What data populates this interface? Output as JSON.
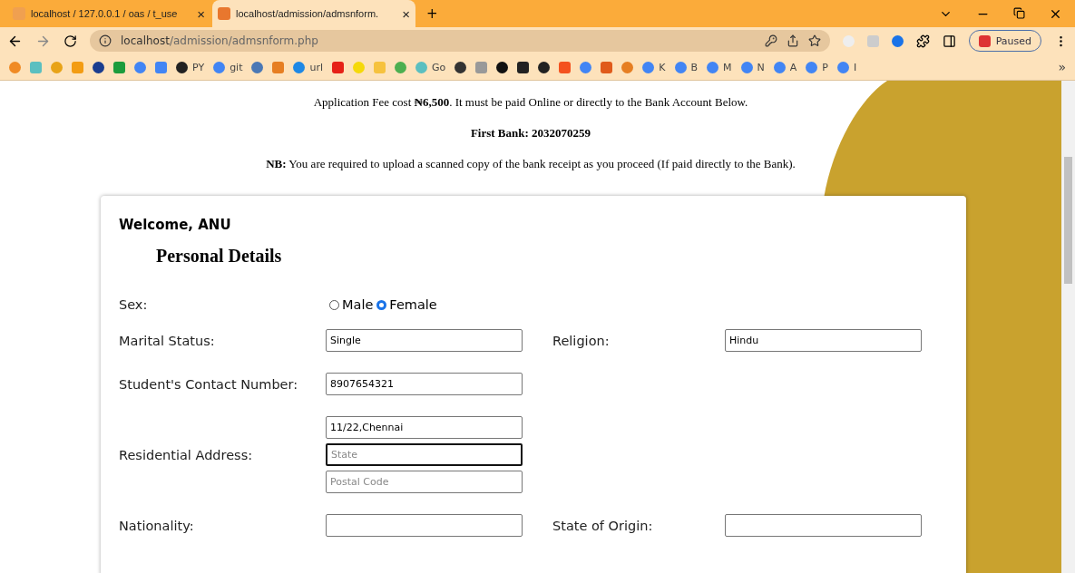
{
  "tabs": [
    {
      "title": "localhost / 127.0.0.1 / oas / t_use",
      "close": "×",
      "selected": false
    },
    {
      "title": "localhost/admission/admsnform.",
      "close": "×",
      "selected": true
    }
  ],
  "new_tab": "+",
  "address_bar": {
    "url_host": "localhost",
    "url_path": "/admission/admsnform.php"
  },
  "profile": {
    "label": "Paused"
  },
  "bookmarks": [
    {
      "kind": "icon",
      "color": "#f08a24"
    },
    {
      "kind": "icon",
      "color": "#5bbfc0"
    },
    {
      "kind": "icon",
      "color": "#e8a317"
    },
    {
      "kind": "icon",
      "color": "#f39c12"
    },
    {
      "kind": "icon",
      "color": "#1a3d8f"
    },
    {
      "kind": "icon",
      "color": "#1c9c3c"
    },
    {
      "kind": "icon",
      "color": "#4285f4"
    },
    {
      "kind": "icon",
      "color": "#4285f4"
    },
    {
      "kind": "text",
      "color": "#222222",
      "label": "PY"
    },
    {
      "kind": "text",
      "color": "#4285f4",
      "label": "git"
    },
    {
      "kind": "icon",
      "color": "#4a78b5"
    },
    {
      "kind": "icon",
      "color": "#e67e22"
    },
    {
      "kind": "text",
      "color": "#1e88e5",
      "label": "url"
    },
    {
      "kind": "icon",
      "color": "#e62117"
    },
    {
      "kind": "icon",
      "color": "#f5d90a"
    },
    {
      "kind": "icon",
      "color": "#f6c23e"
    },
    {
      "kind": "icon",
      "color": "#4caf50"
    },
    {
      "kind": "text",
      "color": "#5bbfc0",
      "label": "Go"
    },
    {
      "kind": "icon",
      "color": "#333333"
    },
    {
      "kind": "icon",
      "color": "#999999"
    },
    {
      "kind": "icon",
      "color": "#111111"
    },
    {
      "kind": "icon",
      "color": "#222222"
    },
    {
      "kind": "icon",
      "color": "#222222"
    },
    {
      "kind": "icon",
      "color": "#f4511e"
    },
    {
      "kind": "icon",
      "color": "#4285f4"
    },
    {
      "kind": "icon",
      "color": "#e05a1a"
    },
    {
      "kind": "icon",
      "color": "#e67e22"
    },
    {
      "kind": "text",
      "color": "#4285f4",
      "label": "K"
    },
    {
      "kind": "text",
      "color": "#4285f4",
      "label": "B"
    },
    {
      "kind": "text",
      "color": "#4285f4",
      "label": "M"
    },
    {
      "kind": "text",
      "color": "#4285f4",
      "label": "N"
    },
    {
      "kind": "text",
      "color": "#4285f4",
      "label": "A"
    },
    {
      "kind": "text",
      "color": "#4285f4",
      "label": "P"
    },
    {
      "kind": "text",
      "color": "#4285f4",
      "label": "I"
    }
  ],
  "more_bookmarks": "»",
  "notice": [
    "Application Fee cost **₦6,500**. It must be paid Online or directly to the Bank Account Below.",
    "**First Bank: 2032070259**",
    "**NB:** You are required to upload a scanned copy of the bank receipt as you proceed (If paid directly to the Bank)."
  ],
  "form": {
    "welcome": "Welcome, ANU",
    "heading": "Personal Details",
    "sex": {
      "label": "Sex:",
      "options": [
        {
          "label": "Male",
          "selected": false
        },
        {
          "label": "Female",
          "selected": true
        }
      ]
    },
    "rows": [
      {
        "label": "Marital Status:",
        "fields": [
          {
            "value": "Single",
            "focused": false
          }
        ],
        "side_label": "Religion:",
        "side_field": {
          "value": "Hindu",
          "focused": false
        }
      },
      {
        "label": "Student's Contact Number:",
        "fields": [
          {
            "value": "8907654321",
            "focused": false
          }
        ]
      },
      {
        "label": "Residential Address:",
        "fields": [
          {
            "value": "11/22,Chennai",
            "focused": false
          },
          {
            "placeholder": "State",
            "focused": true
          },
          {
            "placeholder": "Postal Code",
            "focused": false
          }
        ]
      },
      {
        "label": "Nationality:",
        "fields": [
          {
            "focused": false
          }
        ],
        "side_label": "State of Origin:",
        "side_field": {
          "focused": false
        }
      }
    ]
  }
}
